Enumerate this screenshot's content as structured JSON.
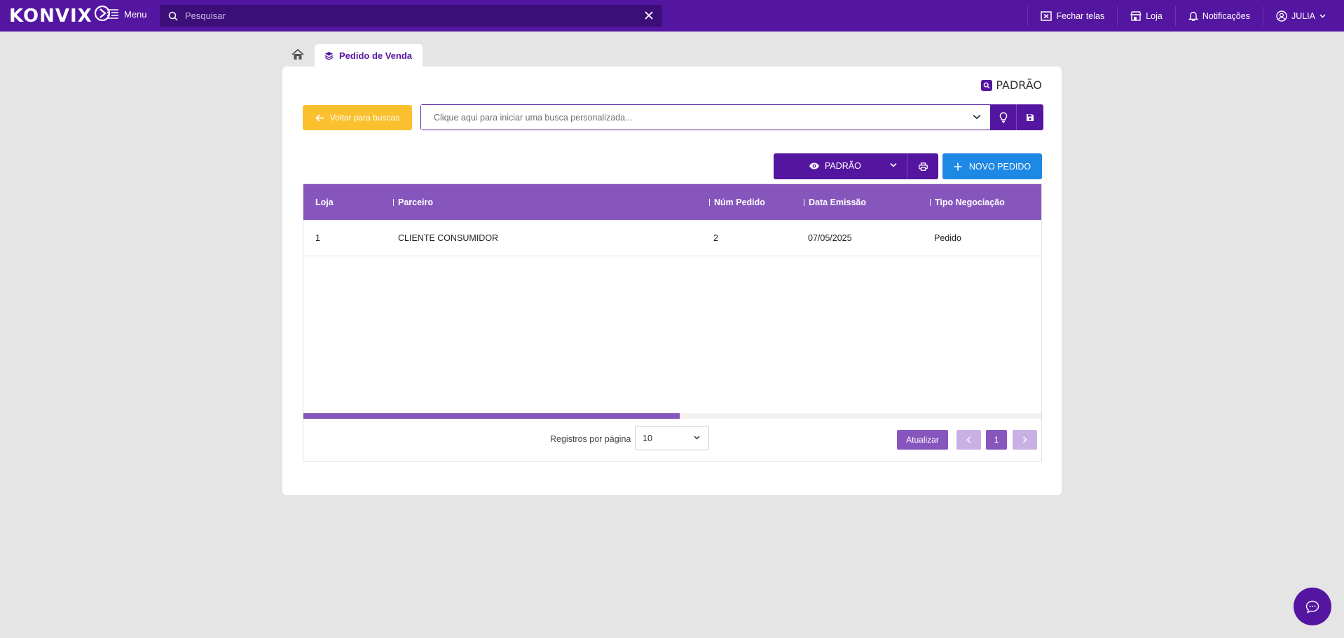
{
  "topbar": {
    "logo_text": "KONVIX",
    "menu_label": "Menu",
    "search_placeholder": "Pesquisar",
    "close_screens_label": "Fechar telas",
    "store_label": "Loja",
    "notifications_label": "Notificações",
    "user_label": "JULIA"
  },
  "tabs": {
    "active_tab_label": "Pedido de Venda"
  },
  "toolbar": {
    "view_badge": "PADRÃO",
    "back_label": "Voltar para buscas",
    "custom_search_placeholder": "Clique aqui para iniciar uma busca personalizada...",
    "view_select_label": "PADRÃO",
    "new_order_label": "NOVO PEDIDO"
  },
  "table": {
    "columns": [
      "Loja",
      "Parceiro",
      "Núm Pedido",
      "Data Emissão",
      "Tipo Negociação"
    ],
    "rows": [
      [
        "1",
        "CLIENTE CONSUMIDOR",
        "2",
        "07/05/2025",
        "Pedido"
      ]
    ],
    "horizontal_scroll_fraction": 0.51
  },
  "pager": {
    "records_label": "Registros por página",
    "page_size": "10",
    "refresh_label": "Atualizar",
    "current_page": "1"
  },
  "colors": {
    "primary": "#5416a0",
    "header": "#8756bd",
    "warning": "#fbc02d",
    "info": "#1e88e5"
  }
}
